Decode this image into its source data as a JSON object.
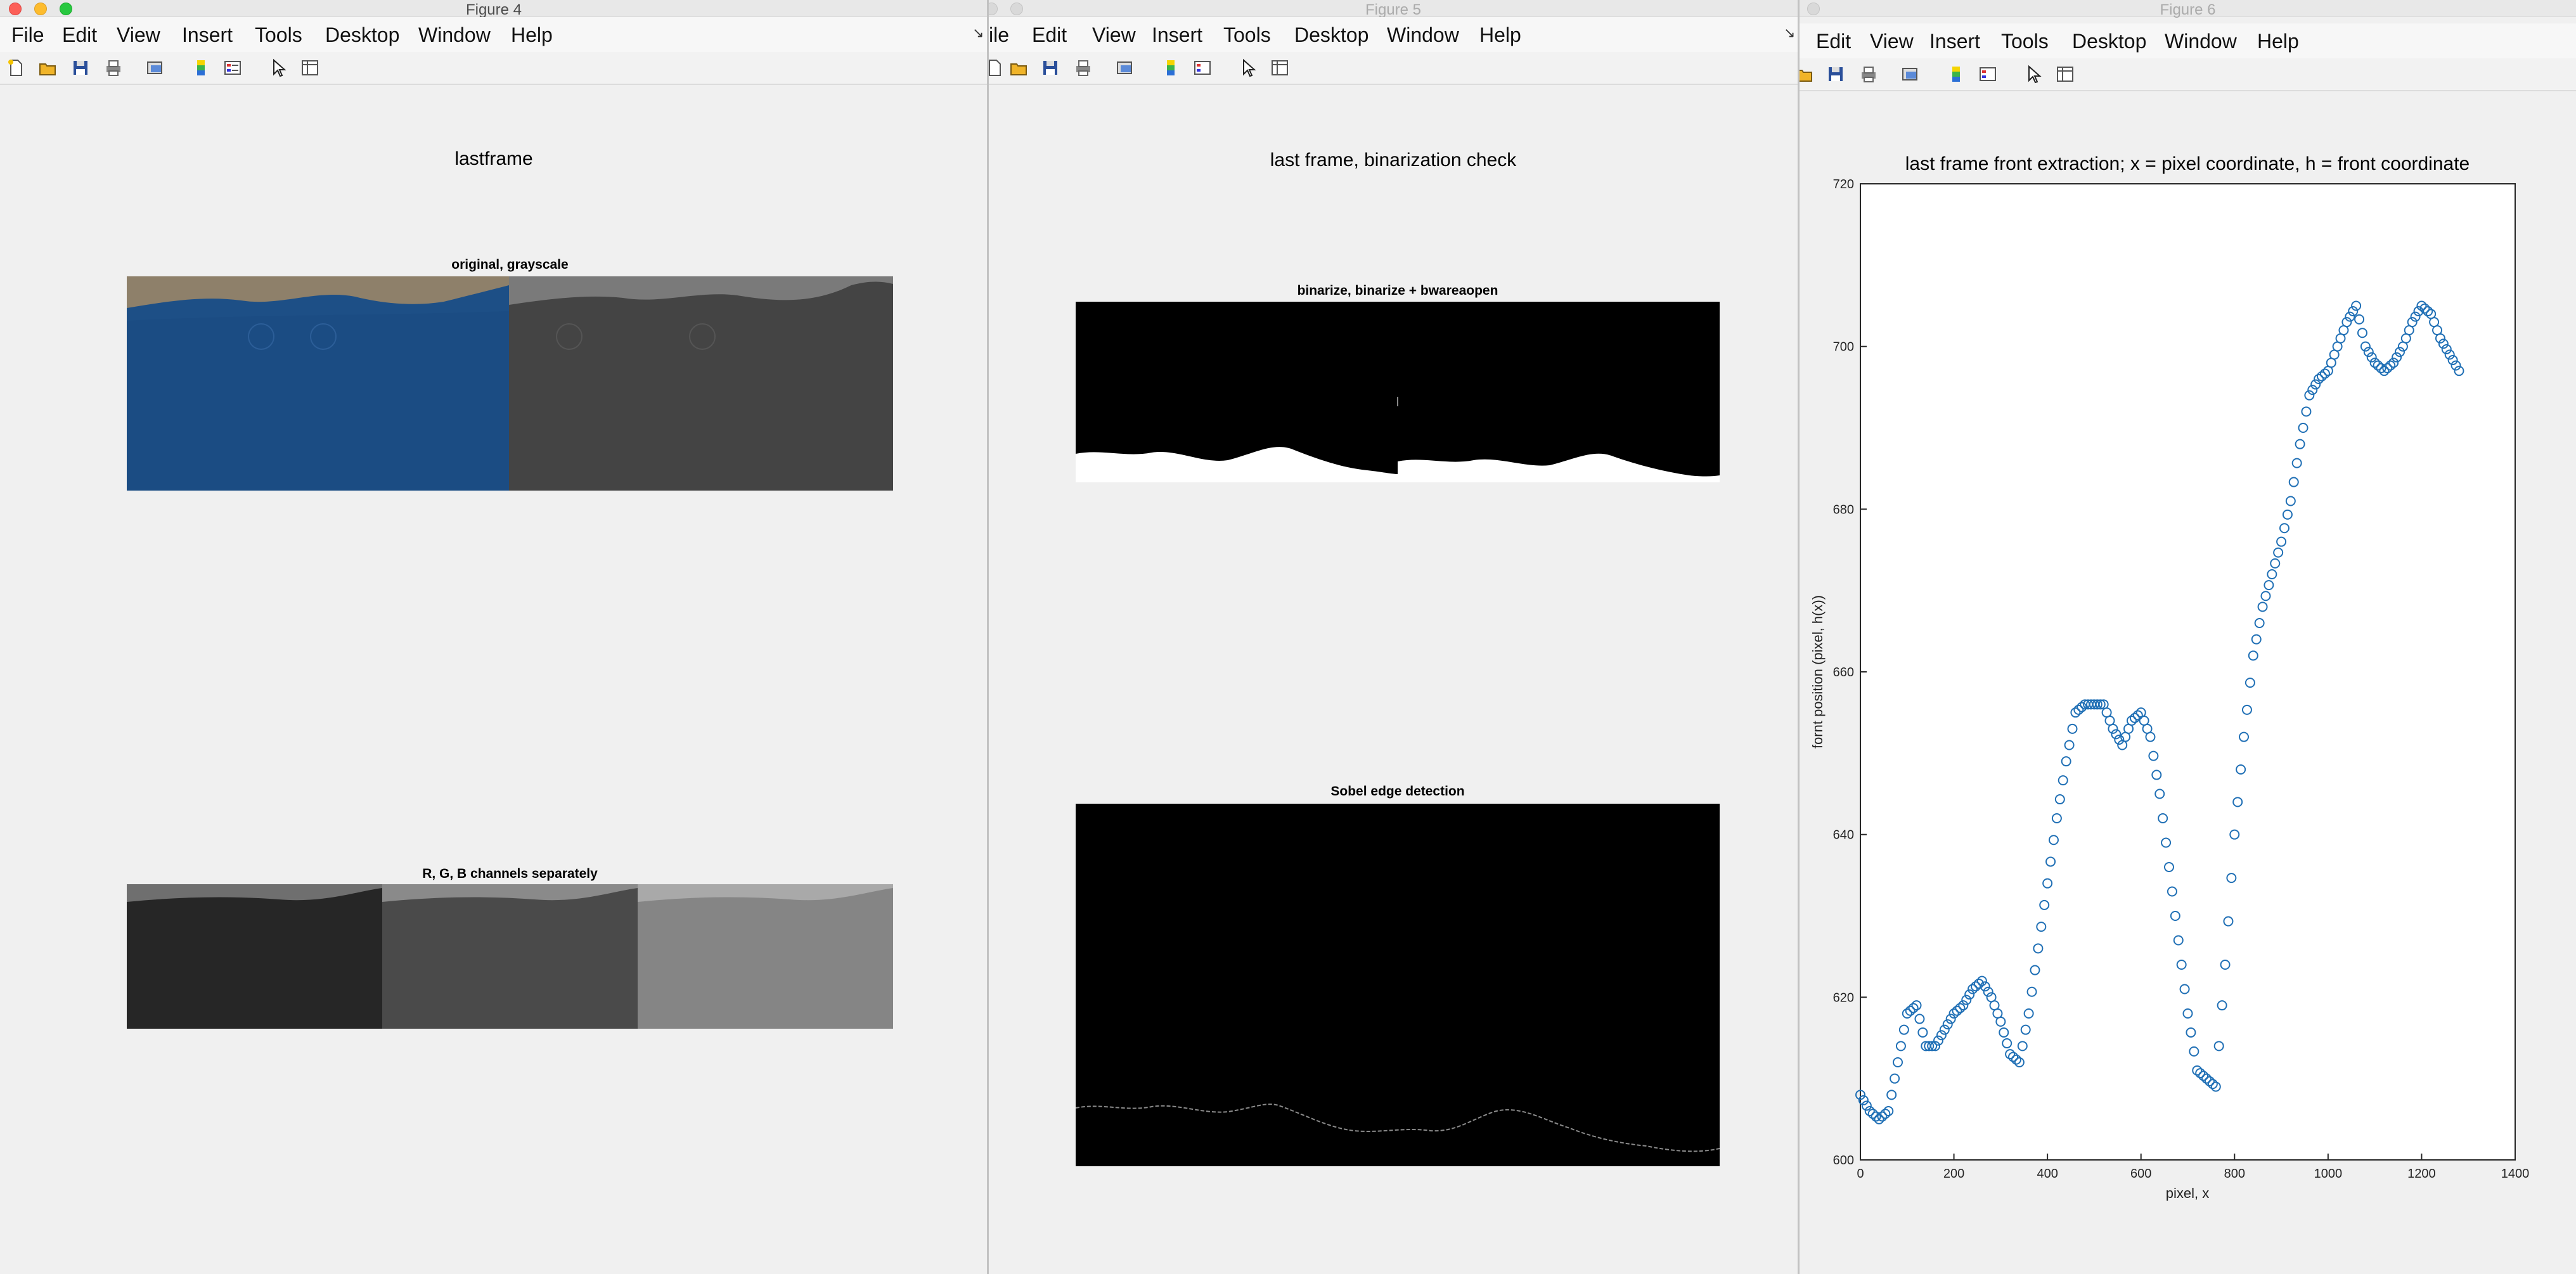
{
  "windows": {
    "fig4": {
      "title": "Figure 4",
      "menu": [
        "File",
        "Edit",
        "View",
        "Insert",
        "Tools",
        "Desktop",
        "Window",
        "Help"
      ],
      "main_title": "lastframe",
      "sub1": "original, grayscale",
      "sub2": "R, G, B channels separately"
    },
    "fig5": {
      "title": "Figure 5",
      "menu": [
        "ile",
        "Edit",
        "View",
        "Insert",
        "Tools",
        "Desktop",
        "Window",
        "Help"
      ],
      "main_title": "last frame, binarization check",
      "sub1": "binarize, binarize + bwareaopen",
      "sub2": "Sobel edge detection"
    },
    "fig6": {
      "title": "Figure 6",
      "menu": [
        "Edit",
        "View",
        "Insert",
        "Tools",
        "Desktop",
        "Window",
        "Help"
      ]
    }
  },
  "toolbar_icons": [
    "new-figure-icon",
    "open-file-icon",
    "save-icon",
    "print-icon",
    "print-preview-icon",
    "colorbar-icon",
    "legend-icon",
    "pointer-icon",
    "property-editor-icon"
  ],
  "chart_data": {
    "type": "scatter",
    "title": "last frame front extraction; x = pixel coordinate, h = front coordinate",
    "xlabel": "pixel, x",
    "ylabel": "fornt position (pixel, h(x))",
    "xlim": [
      0,
      1400
    ],
    "ylim": [
      600,
      720
    ],
    "xticks": [
      0,
      200,
      400,
      600,
      800,
      1000,
      1200,
      1400
    ],
    "yticks": [
      600,
      620,
      640,
      660,
      680,
      700,
      720
    ],
    "marker": "open-circle",
    "color": "#1f6fb5",
    "x": [
      0,
      20,
      40,
      60,
      80,
      100,
      120,
      140,
      160,
      180,
      200,
      220,
      240,
      260,
      280,
      300,
      320,
      340,
      360,
      380,
      400,
      420,
      440,
      460,
      480,
      500,
      520,
      540,
      560,
      580,
      600,
      620,
      640,
      660,
      680,
      700,
      720,
      740,
      760,
      780,
      800,
      820,
      840,
      860,
      880,
      900,
      920,
      940,
      960,
      980,
      1000,
      1020,
      1040,
      1060,
      1080,
      1100,
      1120,
      1140,
      1160,
      1180,
      1200,
      1220,
      1240,
      1260,
      1280
    ],
    "values": [
      608,
      606,
      605,
      606,
      612,
      618,
      619,
      614,
      614,
      616,
      618,
      619,
      621,
      622,
      620,
      617,
      613,
      612,
      618,
      626,
      634,
      642,
      649,
      655,
      656,
      656,
      656,
      653,
      651,
      654,
      655,
      652,
      645,
      636,
      627,
      618,
      611,
      610,
      609,
      624,
      640,
      652,
      662,
      668,
      672,
      676,
      681,
      688,
      694,
      696,
      697,
      700,
      703,
      705,
      700,
      698,
      697,
      698,
      700,
      703,
      705,
      704,
      701,
      699,
      697
    ]
  }
}
